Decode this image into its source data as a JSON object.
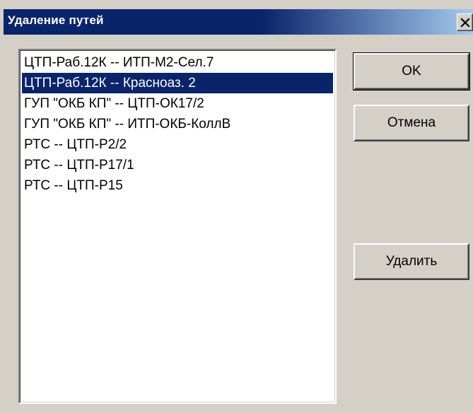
{
  "dialog": {
    "title": "Удаление путей",
    "close_symbol": "×"
  },
  "list": {
    "items": [
      "ЦТП-Раб.12К -- ИТП-М2-Сел.7",
      "ЦТП-Раб.12К -- Красноаз. 2",
      "ГУП \"ОКБ КП\" -- ЦТП-ОК17/2",
      "ГУП \"ОКБ КП\" -- ИТП-ОКБ-КоллВ",
      "РТС -- ЦТП-Р2/2",
      "РТС -- ЦТП-Р17/1",
      "РТС -- ЦТП-Р15"
    ],
    "selected_index": 1
  },
  "buttons": {
    "ok_label": "OK",
    "cancel_label": "Отмена",
    "delete_label": "Удалить"
  },
  "colors": {
    "face": "#d4d0c8",
    "title_bar": "#0a246a",
    "selection": "#0a246a"
  },
  "icons": {
    "close": "close-icon"
  }
}
